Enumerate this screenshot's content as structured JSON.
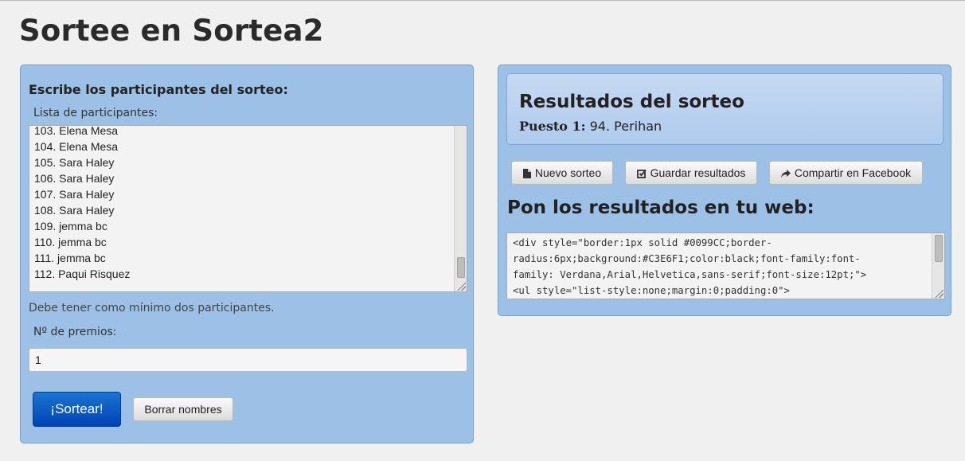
{
  "page": {
    "title": "Sortee en Sortea2"
  },
  "left_panel": {
    "heading": "Escribe los participantes del sorteo:",
    "list_label": "Lista de participantes:",
    "participants": [
      "103. Elena Mesa",
      "104. Elena Mesa",
      "105. Sara Haley",
      "106. Sara Haley",
      "107. Sara Haley",
      "108. Sara Haley",
      "109. jemma bc",
      "110. jemma bc",
      "111. jemma bc",
      "112. Paqui Risquez"
    ],
    "warning": "Debe tener como mínimo dos participantes.",
    "prizes_label": "Nº de premios:",
    "prizes_value": "1",
    "draw_button": "¡Sortear!",
    "clear_button": "Borrar nombres"
  },
  "right_panel": {
    "results_title": "Resultados del sorteo",
    "result_label": "Puesto 1:",
    "result_value": "94. Perihan",
    "buttons": {
      "new_draw": "Nuevo sorteo",
      "save_results": "Guardar resultados",
      "share_facebook": "Compartir en Facebook"
    },
    "embed_heading": "Pon los resultados en tu web:",
    "embed_code_lines": [
      "<div style=\"border:1px solid #0099CC;border-",
      "radius:6px;background:#C3E6F1;color:black;font-family:font-",
      "family: Verdana,Arial,Helvetica,sans-serif;font-size:12pt;\">",
      "<ul style=\"list-style:none;margin:0;padding:0\">"
    ]
  },
  "icons": {
    "new_draw": "document-icon",
    "save_results": "edit-check-icon",
    "share_facebook": "share-arrow-icon"
  },
  "colors": {
    "panel_background": "#9dc0e6",
    "primary_button": "#0050c0"
  }
}
